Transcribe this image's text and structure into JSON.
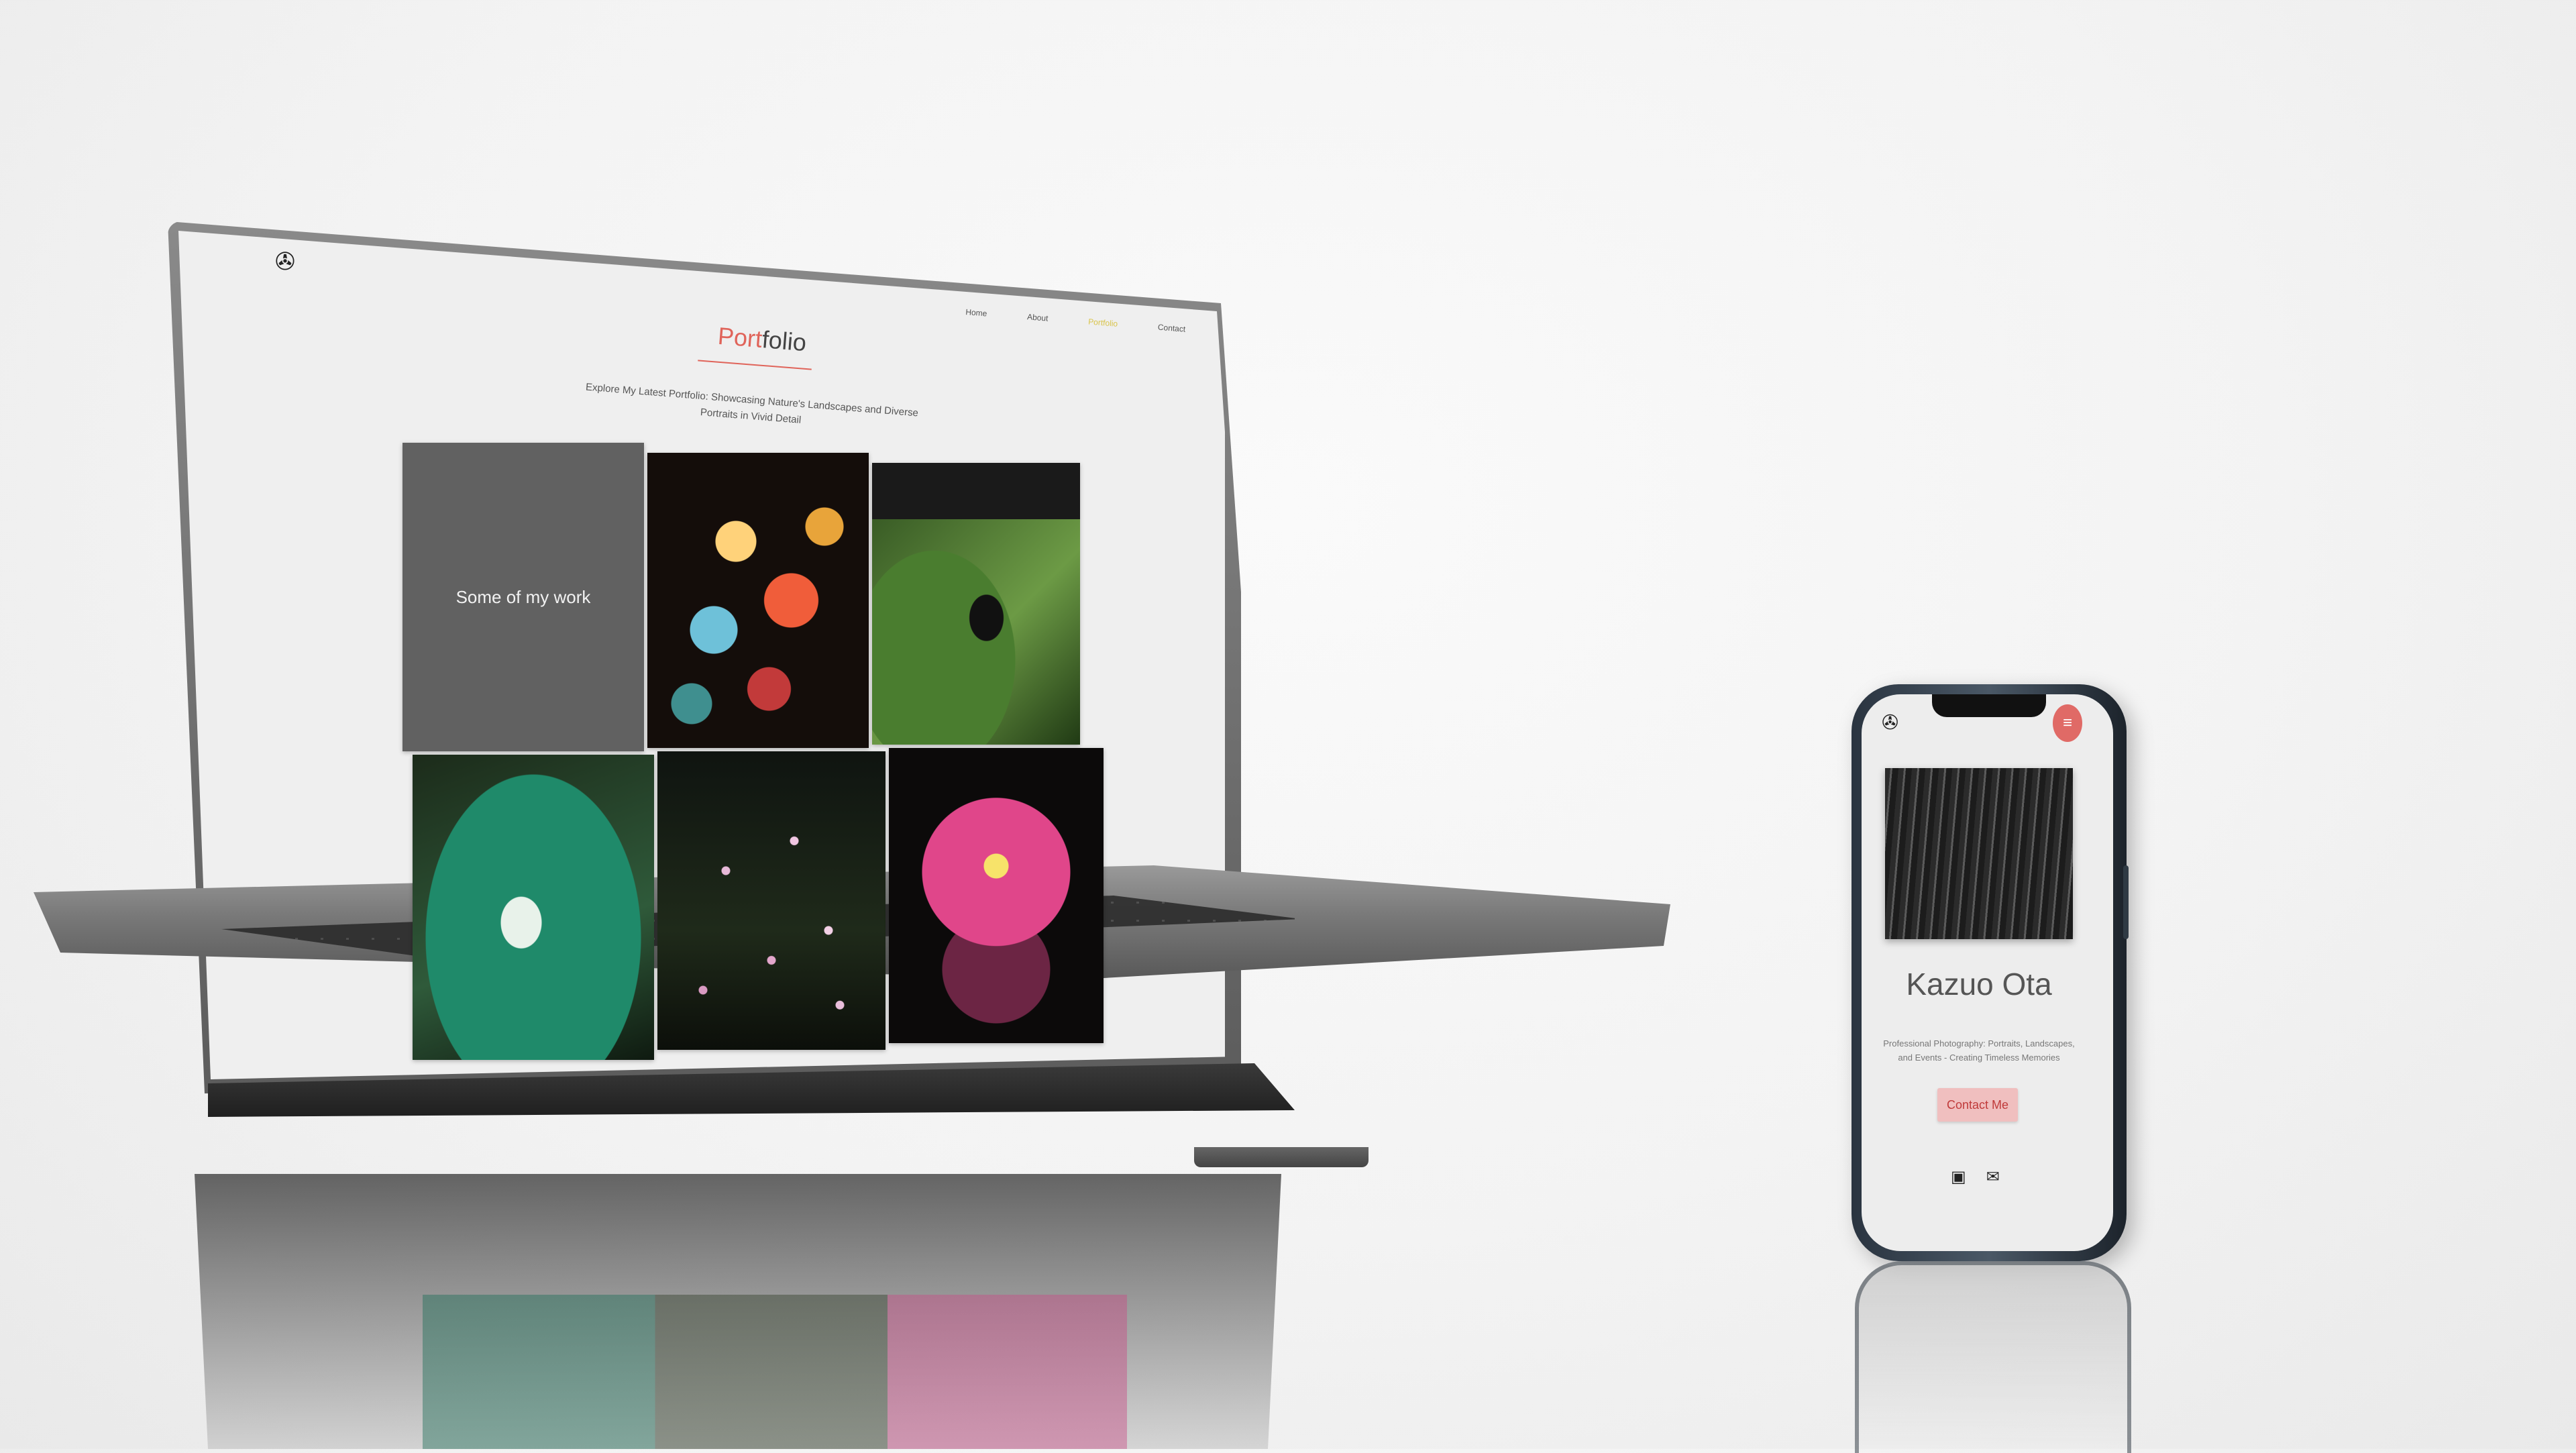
{
  "laptop_site": {
    "logo_icon": "aperture-icon",
    "nav": [
      {
        "label": "Home",
        "active": false
      },
      {
        "label": "About",
        "active": false
      },
      {
        "label": "Portfolio",
        "active": true
      },
      {
        "label": "Contact",
        "active": false
      }
    ],
    "title_accent": "Port",
    "title_rest": "folio",
    "description": "Explore My Latest Portfolio: Showcasing Nature's Landscapes and Diverse Portraits in Vivid Detail",
    "intro_tile": "Some of my work",
    "colors": {
      "accent": "#e0645a",
      "nav_active": "#d9c44a",
      "intro_tile_bg": "#616161"
    }
  },
  "phone_site": {
    "logo_icon": "aperture-icon",
    "menu_icon": "hamburger-menu-icon",
    "name": "Kazuo Ota",
    "tagline": "Professional Photography: Portraits, Landscapes, and Events - Creating Timeless Memories",
    "cta_label": "Contact Me",
    "social_icons": [
      "instagram-icon",
      "mail-icon"
    ],
    "colors": {
      "menu_button": "#e06a66",
      "cta_bg": "#f0bfbf",
      "cta_text": "#c03a3a"
    }
  }
}
